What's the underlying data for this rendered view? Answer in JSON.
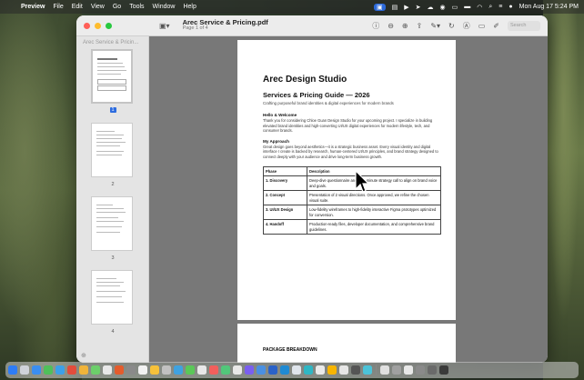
{
  "menubar": {
    "app_name": "Preview",
    "items": [
      "File",
      "Edit",
      "View",
      "Go",
      "Tools",
      "Window",
      "Help"
    ],
    "datetime": "Mon Aug 17  5:24 PM"
  },
  "window": {
    "title": "Arec Service & Pricing.pdf",
    "subtitle": "Page 1 of 4",
    "search_placeholder": "Search"
  },
  "sidebar": {
    "title": "Arec Service & Pricin...",
    "pages": [
      {
        "number": "1",
        "selected": true
      },
      {
        "number": "2",
        "selected": false
      },
      {
        "number": "3",
        "selected": false
      },
      {
        "number": "4",
        "selected": false
      }
    ]
  },
  "document": {
    "studio": "Arec Design Studio",
    "guide_title": "Services & Pricing Guide — 2026",
    "guide_subtitle": "Crafting purposeful brand identities & digital experiences for modern brands",
    "welcome_head": "Hello & Welcome",
    "welcome_text": "Thank you for considering Chloe Guan Design Studio for your upcoming project. I specialize in building elevated brand identities and high-converting UI/UX digital experiences for modern lifestyle, tech, and consumer brands.",
    "approach_head": "My Approach",
    "approach_text": "Great design goes beyond aesthetics—it is a strategic business asset. Every visual identity and digital interface I create is backed by research, human-centered UI/UX principles, and brand strategy designed to connect deeply with your audience and drive long-term business growth.",
    "table": {
      "headers": [
        "Phase",
        "Description"
      ],
      "rows": [
        {
          "phase": "1. Discovery",
          "desc": "Deep-dive questionnaire and a 45-minute strategy call to align on brand voice and goals."
        },
        {
          "phase": "2. Concept",
          "desc": "Presentation of 2 visual directions. Once approved, we refine the chosen visual suite."
        },
        {
          "phase": "3. UI/UX Design",
          "desc": "Low-fidelity wireframes to high-fidelity interactive Figma prototypes optimized for conversion."
        },
        {
          "phase": "4. Handoff",
          "desc": "Production-ready files, developer documentation, and comprehensive brand guidelines."
        }
      ]
    },
    "page2_heading": "PACKAGE BREAKDOWN"
  },
  "dock": {
    "icon_colors": [
      "#2d7cf6",
      "#cfd3da",
      "#3a8ef0",
      "#4fc05a",
      "#3ca0e8",
      "#e24c3c",
      "#f0b43a",
      "#6ccf6a",
      "#e8e8e8",
      "#e45c2c",
      "#8a8a8a",
      "#f2f2f2",
      "#f6c13a",
      "#c1c1c1",
      "#3fa2e0",
      "#5ac858",
      "#e8e8e8",
      "#f25f5c",
      "#52c77a",
      "#e8e8e8",
      "#7a5ff0",
      "#4a90e2",
      "#2a62c8",
      "#1f8ad3",
      "#dfe5ec",
      "#2fb7c4",
      "#eaeaea",
      "#f7b500",
      "#e6e6e6",
      "#555555",
      "#4cc3d8",
      "#e0e0e0",
      "#a0a0a0",
      "#e8e8e8",
      "#8a8a8a",
      "#6a6a6a",
      "#3a3a3a"
    ]
  }
}
